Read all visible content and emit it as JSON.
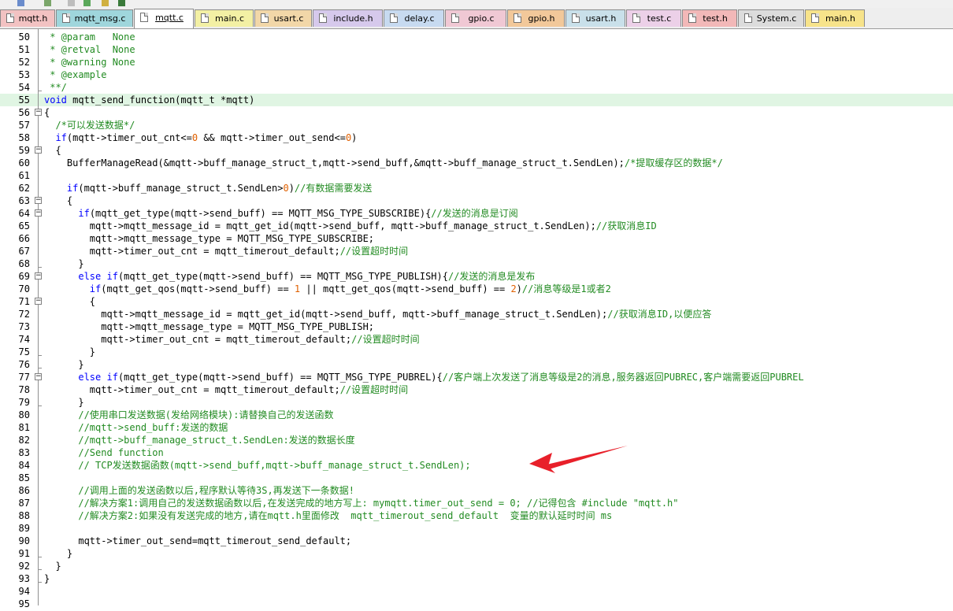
{
  "tabs": [
    {
      "label": "mqtt.h",
      "color": "#f2c2c2",
      "active": false
    },
    {
      "label": "mqtt_msg.c",
      "color": "#9fd6dc",
      "active": false
    },
    {
      "label": "mqtt.c",
      "color": "#b4e3ad",
      "active": true
    },
    {
      "label": "main.c",
      "color": "#f3f0a4",
      "active": false
    },
    {
      "label": "usart.c",
      "color": "#f2d7a8",
      "active": false
    },
    {
      "label": "include.h",
      "color": "#d6c9ec",
      "active": false
    },
    {
      "label": "delay.c",
      "color": "#c7daf0",
      "active": false
    },
    {
      "label": "gpio.c",
      "color": "#f0c8d4",
      "active": false
    },
    {
      "label": "gpio.h",
      "color": "#f2c89a",
      "active": false
    },
    {
      "label": "usart.h",
      "color": "#c9e0ea",
      "active": false
    },
    {
      "label": "test.c",
      "color": "#ecd0e8",
      "active": false
    },
    {
      "label": "test.h",
      "color": "#f2b8b8",
      "active": false
    },
    {
      "label": "System.c",
      "color": "#dcdcdc",
      "active": false
    },
    {
      "label": "main.h",
      "color": "#f7e38a",
      "active": false
    }
  ],
  "lines": [
    {
      "n": "50",
      "t": " * @param   None"
    },
    {
      "n": "51",
      "t": " * @retval  None"
    },
    {
      "n": "52",
      "t": " * @warning None"
    },
    {
      "n": "53",
      "t": " * @example"
    },
    {
      "n": "54",
      "t": " **/"
    },
    {
      "n": "55",
      "t": "void mqtt_send_function(mqtt_t *mqtt)"
    },
    {
      "n": "56",
      "t": "{"
    },
    {
      "n": "57",
      "t": "  /*可以发送数据*/"
    },
    {
      "n": "58",
      "t": "  if(mqtt->timer_out_cnt<=0 && mqtt->timer_out_send<=0)"
    },
    {
      "n": "59",
      "t": "  {"
    },
    {
      "n": "60",
      "t": "    BufferManageRead(&mqtt->buff_manage_struct_t,mqtt->send_buff,&mqtt->buff_manage_struct_t.SendLen);/*提取缓存区的数据*/"
    },
    {
      "n": "61",
      "t": ""
    },
    {
      "n": "62",
      "t": "    if(mqtt->buff_manage_struct_t.SendLen>0)//有数据需要发送"
    },
    {
      "n": "63",
      "t": "    {"
    },
    {
      "n": "64",
      "t": "      if(mqtt_get_type(mqtt->send_buff) == MQTT_MSG_TYPE_SUBSCRIBE){//发送的消息是订阅"
    },
    {
      "n": "65",
      "t": "        mqtt->mqtt_message_id = mqtt_get_id(mqtt->send_buff, mqtt->buff_manage_struct_t.SendLen);//获取消息ID"
    },
    {
      "n": "66",
      "t": "        mqtt->mqtt_message_type = MQTT_MSG_TYPE_SUBSCRIBE;"
    },
    {
      "n": "67",
      "t": "        mqtt->timer_out_cnt = mqtt_timerout_default;//设置超时时间"
    },
    {
      "n": "68",
      "t": "      }"
    },
    {
      "n": "69",
      "t": "      else if(mqtt_get_type(mqtt->send_buff) == MQTT_MSG_TYPE_PUBLISH){//发送的消息是发布"
    },
    {
      "n": "70",
      "t": "        if(mqtt_get_qos(mqtt->send_buff) == 1 || mqtt_get_qos(mqtt->send_buff) == 2)//消息等级是1或者2"
    },
    {
      "n": "71",
      "t": "        {"
    },
    {
      "n": "72",
      "t": "          mqtt->mqtt_message_id = mqtt_get_id(mqtt->send_buff, mqtt->buff_manage_struct_t.SendLen);//获取消息ID,以便应答"
    },
    {
      "n": "73",
      "t": "          mqtt->mqtt_message_type = MQTT_MSG_TYPE_PUBLISH;"
    },
    {
      "n": "74",
      "t": "          mqtt->timer_out_cnt = mqtt_timerout_default;//设置超时时间"
    },
    {
      "n": "75",
      "t": "        }"
    },
    {
      "n": "76",
      "t": "      }"
    },
    {
      "n": "77",
      "t": "      else if(mqtt_get_type(mqtt->send_buff) == MQTT_MSG_TYPE_PUBREL){//客户端上次发送了消息等级是2的消息,服务器返回PUBREC,客户端需要返回PUBREL"
    },
    {
      "n": "78",
      "t": "        mqtt->timer_out_cnt = mqtt_timerout_default;//设置超时时间"
    },
    {
      "n": "79",
      "t": "      }"
    },
    {
      "n": "80",
      "t": "      //使用串口发送数据(发给网络模块):请替换自己的发送函数"
    },
    {
      "n": "81",
      "t": "      //mqtt->send_buff:发送的数据"
    },
    {
      "n": "82",
      "t": "      //mqtt->buff_manage_struct_t.SendLen:发送的数据长度"
    },
    {
      "n": "83",
      "t": "      //Send function"
    },
    {
      "n": "84",
      "t": "      // TCP发送数据函数(mqtt->send_buff,mqtt->buff_manage_struct_t.SendLen);"
    },
    {
      "n": "85",
      "t": ""
    },
    {
      "n": "86",
      "t": "      //调用上面的发送函数以后,程序默认等待3S,再发送下一条数据!"
    },
    {
      "n": "87",
      "t": "      //解决方案1:调用自己的发送数据函数以后,在发送完成的地方写上: mymqtt.timer_out_send = 0; //记得包含 #include \"mqtt.h\""
    },
    {
      "n": "88",
      "t": "      //解决方案2:如果没有发送完成的地方,请在mqtt.h里面修改  mqtt_timerout_send_default  变量的默认延时时间 ms"
    },
    {
      "n": "89",
      "t": ""
    },
    {
      "n": "90",
      "t": "      mqtt->timer_out_send=mqtt_timerout_send_default;"
    },
    {
      "n": "91",
      "t": "    }"
    },
    {
      "n": "92",
      "t": "  }"
    },
    {
      "n": "93",
      "t": "}"
    },
    {
      "n": "94",
      "t": ""
    },
    {
      "n": "95",
      "t": ""
    }
  ],
  "highlight_line": "55",
  "annotation": {
    "color": "#e8202a",
    "icon": "red-arrow-icon"
  }
}
